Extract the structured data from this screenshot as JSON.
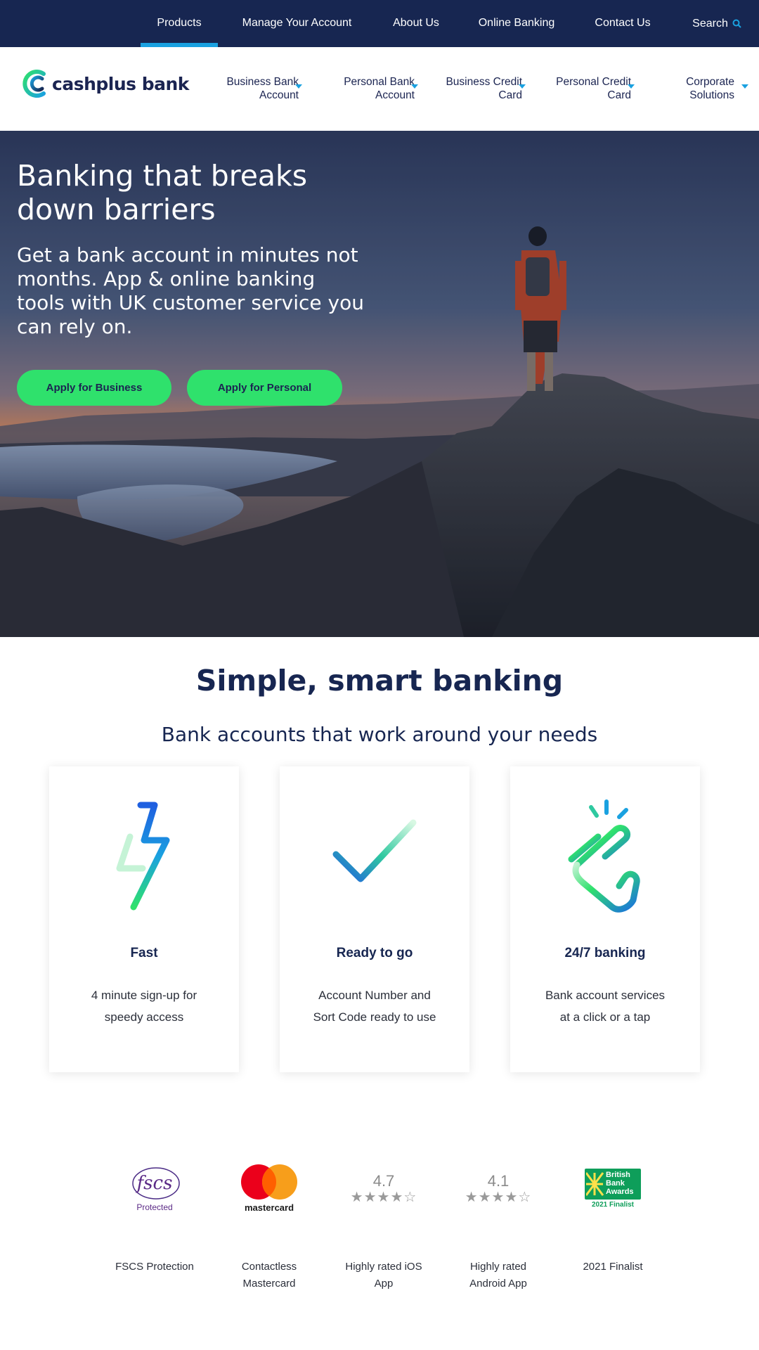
{
  "colors": {
    "navy": "#172651",
    "accent_blue": "#1aa1e0",
    "cta_green": "#2fe16c",
    "white": "#ffffff"
  },
  "topnav": {
    "items": [
      "Products",
      "Manage Your Account",
      "About Us",
      "Online Banking",
      "Contact Us"
    ],
    "search_label": "Search",
    "search_icon": "search-icon",
    "active": "Products"
  },
  "brand": {
    "name": "cashplus bank"
  },
  "mainnav": [
    {
      "line1": "Business Bank",
      "line2": "Account"
    },
    {
      "line1": "Personal Bank",
      "line2": "Account"
    },
    {
      "line1": "Business Credit",
      "line2": "Card"
    },
    {
      "line1": "Personal Credit",
      "line2": "Card"
    },
    {
      "line1": "Corporate",
      "line2": "Solutions"
    }
  ],
  "hero": {
    "title": "Banking that breaks down barriers",
    "subtitle": "Get a bank account in minutes not months. App & online banking tools with UK customer service you can rely on.",
    "cta_business": "Apply for Business",
    "cta_personal": "Apply for Personal"
  },
  "section": {
    "title": "Simple, smart banking",
    "subtitle": "Bank accounts that work around your needs"
  },
  "cards": [
    {
      "icon": "lightning-icon",
      "title": "Fast",
      "line1": "4 minute sign-up for",
      "line2": "speedy access"
    },
    {
      "icon": "checkmark-icon",
      "title": "Ready to go",
      "line1": "Account Number and",
      "line2": "Sort Code ready to use"
    },
    {
      "icon": "tap-hand-icon",
      "title": "24/7 banking",
      "line1": "Bank account services",
      "line2": "at a click or a tap"
    }
  ],
  "trust": [
    {
      "logo_text": "fscs",
      "logo_sub": "Protected",
      "line1": "FSCS Protection",
      "line2": ""
    },
    {
      "logo_text": "mastercard",
      "line1": "Contactless",
      "line2": "Mastercard"
    },
    {
      "rating": "4.7",
      "rating_stars": 4.7,
      "line1": "Highly rated iOS",
      "line2": "App"
    },
    {
      "rating": "4.1",
      "rating_stars": 4.1,
      "line1": "Highly rated",
      "line2": "Android App"
    },
    {
      "logo_line1": "British",
      "logo_line2": "Bank",
      "logo_line3": "Awards",
      "logo_sub": "2021 Finalist",
      "line1": "2021 Finalist",
      "line2": ""
    }
  ]
}
